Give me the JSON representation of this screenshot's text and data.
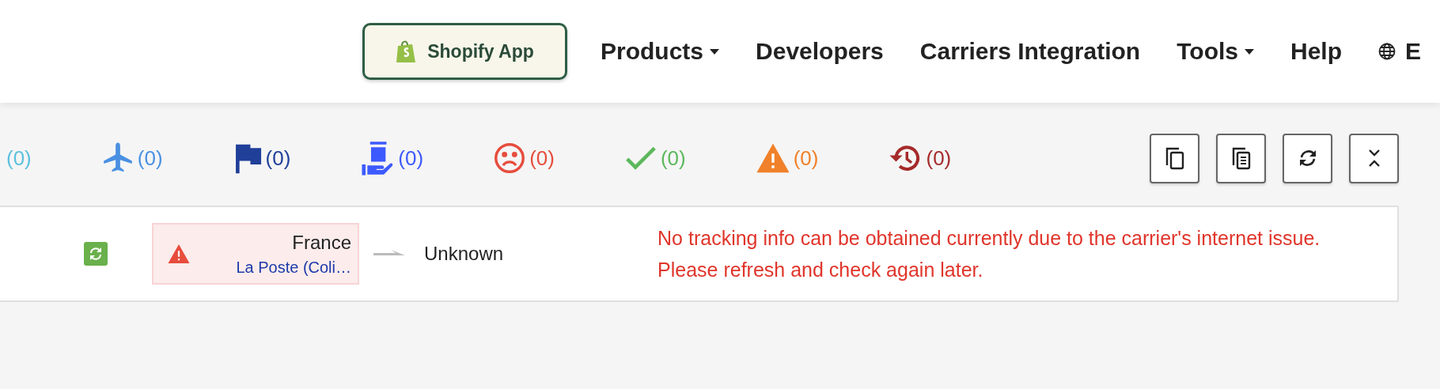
{
  "header": {
    "app_button": "Shopify App",
    "nav": [
      {
        "label": "Products",
        "dropdown": true
      },
      {
        "label": "Developers",
        "dropdown": false
      },
      {
        "label": "Carriers Integration",
        "dropdown": false
      },
      {
        "label": "Tools",
        "dropdown": true
      },
      {
        "label": "Help",
        "dropdown": false
      }
    ],
    "language": "E"
  },
  "status_filters": [
    {
      "kind": "none",
      "count": "(0)",
      "color": "#5bc0de"
    },
    {
      "kind": "plane",
      "count": "(0)",
      "color": "#4a90e2"
    },
    {
      "kind": "flag",
      "count": "(0)",
      "color": "#1f3f99"
    },
    {
      "kind": "pickup",
      "count": "(0)",
      "color": "#3d5afe"
    },
    {
      "kind": "sad",
      "count": "(0)",
      "color": "#e74c3c"
    },
    {
      "kind": "check",
      "count": "(0)",
      "color": "#5cb85c"
    },
    {
      "kind": "warning",
      "count": "(0)",
      "color": "#f0812a"
    },
    {
      "kind": "history",
      "count": "(0)",
      "color": "#a52a2a"
    }
  ],
  "toolbar": [
    {
      "kind": "copy"
    },
    {
      "kind": "copy-list"
    },
    {
      "kind": "refresh"
    },
    {
      "kind": "collapse"
    }
  ],
  "shipment": {
    "origin_country": "France",
    "carrier": "La Poste (Coli…",
    "destination": "Unknown",
    "message": "No tracking info can be obtained currently due to the carrier's internet issue. Please refresh and check again later."
  }
}
